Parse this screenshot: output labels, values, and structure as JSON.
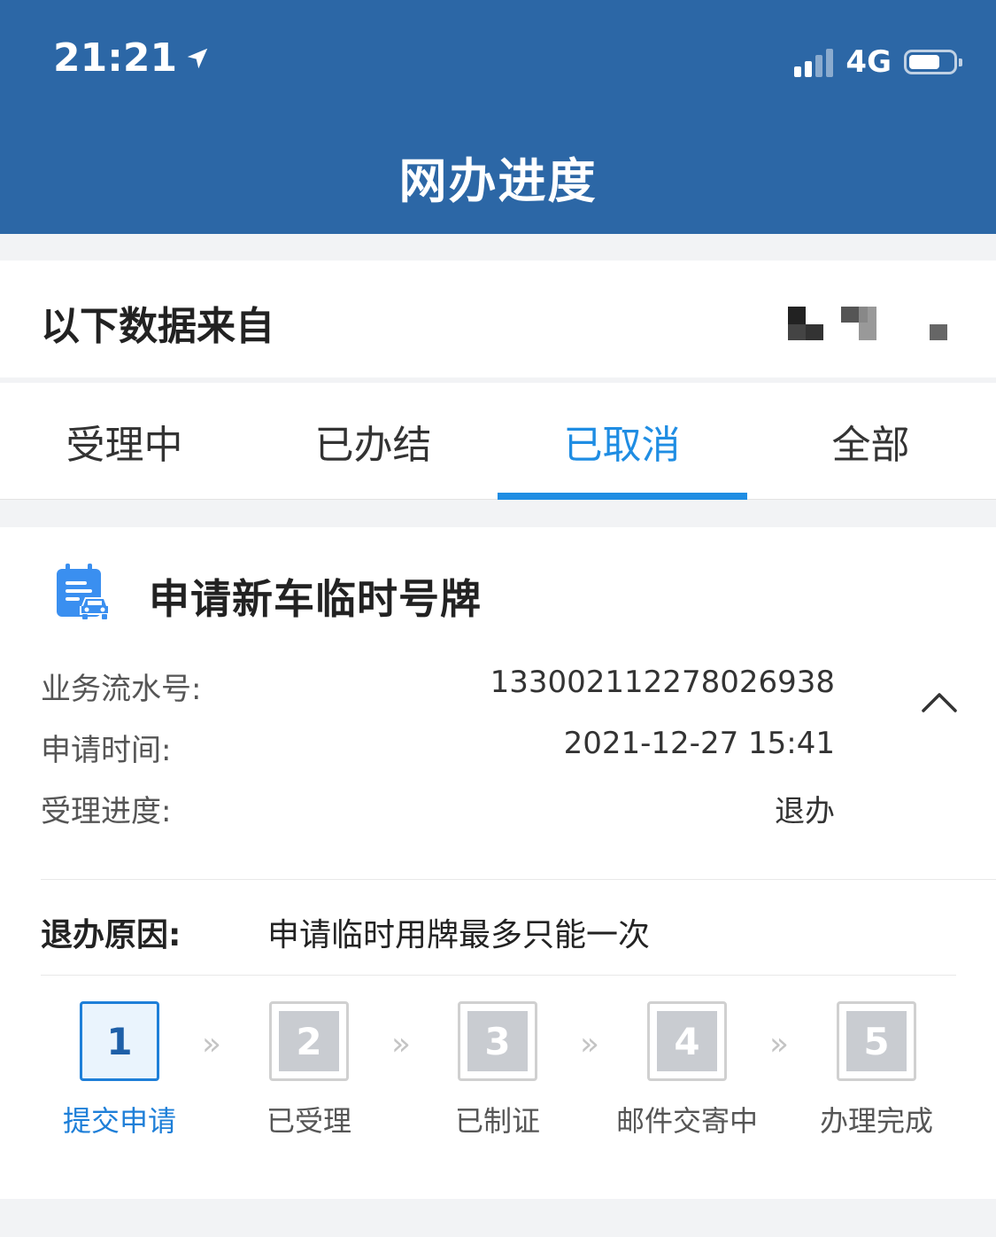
{
  "status_bar": {
    "time": "21:21",
    "network": "4G",
    "location_icon": "location-arrow-icon",
    "signal_icon": "signal-bars-icon",
    "battery_icon": "battery-icon"
  },
  "header": {
    "title": "网办进度",
    "background": "#2c67a6"
  },
  "source": {
    "label": "以下数据来自"
  },
  "tabs": {
    "items": [
      {
        "label": "受理中"
      },
      {
        "label": "已办结"
      },
      {
        "label": "已取消"
      },
      {
        "label": "全部"
      }
    ],
    "active_index": 2,
    "active_color": "#1f8de3"
  },
  "card": {
    "icon": "calendar-car-icon",
    "title": "申请新车临时号牌",
    "fields": {
      "serial_label": "业务流水号:",
      "serial_value": "133002112278026938",
      "time_label": "申请时间:",
      "time_value": "2021-12-27 15:41",
      "progress_label": "受理进度:",
      "progress_value": "退办"
    },
    "collapse_icon": "chevron-up-icon",
    "reason_label": "退办原因:",
    "reason_text": "申请临时用牌最多只能一次"
  },
  "steps": {
    "separator": "»",
    "items": [
      {
        "number": "1",
        "label": "提交申请"
      },
      {
        "number": "2",
        "label": "已受理"
      },
      {
        "number": "3",
        "label": "已制证"
      },
      {
        "number": "4",
        "label": "邮件交寄中"
      },
      {
        "number": "5",
        "label": "办理完成"
      }
    ],
    "current_index": 0
  }
}
